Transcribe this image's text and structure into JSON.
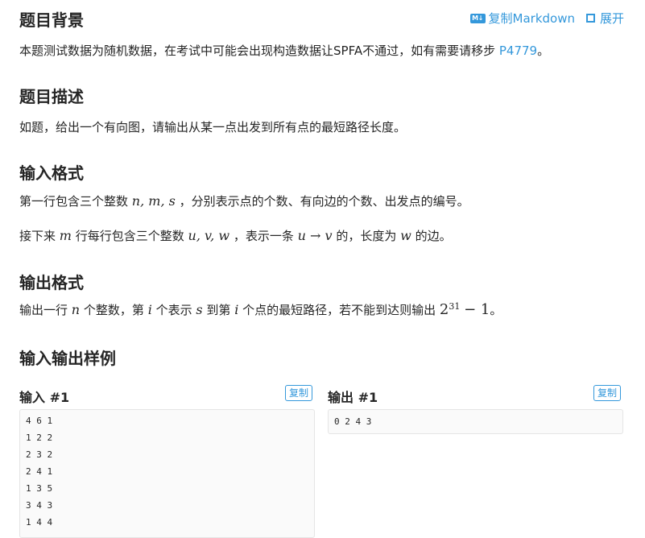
{
  "header_actions": {
    "copy_markdown_icon": "M↓",
    "copy_markdown": "复制Markdown",
    "expand": "展开"
  },
  "sections": {
    "background": {
      "title": "题目背景",
      "text": "本题测试数据为随机数据，在考试中可能会出现构造数据让SPFA不通过，如有需要请移步",
      "link": "P4779",
      "tail": "。"
    },
    "description": {
      "title": "题目描述",
      "text": "如题，给出一个有向图，请输出从某一点出发到所有点的最短路径长度。"
    },
    "input_format": {
      "title": "输入格式",
      "line1": {
        "pre": "第一行包含三个整数",
        "math": "n, m, s",
        "post": "，分别表示点的个数、有向边的个数、出发点的编号。"
      },
      "line2": {
        "pre": "接下来",
        "m1": "m",
        "mid1": "行每行包含三个整数",
        "m2": "u, v, w",
        "mid2": "，表示一条",
        "m3": "u → v",
        "mid3": "的，长度为",
        "m4": "w",
        "post": "的边。"
      }
    },
    "output_format": {
      "title": "输出格式",
      "line": {
        "pre": "输出一行",
        "m1": "n",
        "mid1": "个整数，第",
        "m2": "i",
        "mid2": "个表示",
        "m3": "s",
        "mid3": "到第",
        "m4": "i",
        "mid4": "个点的最短路径，若不能到达则输出",
        "base": "2",
        "exp": "31",
        "minus": "− 1",
        "post": "。"
      }
    },
    "samples": {
      "title": "输入输出样例",
      "input_label": "输入 #1",
      "output_label": "输出 #1",
      "copy": "复制",
      "input_lines": [
        "4 6 1",
        "1 2 2",
        "2 3 2",
        "2 4 1",
        "1 3 5",
        "3 4 3",
        "1 4 4"
      ],
      "output_lines": [
        "0 2 4 3"
      ]
    }
  },
  "colors": {
    "accent": "#3498db",
    "text": "#262626",
    "code_bg": "#fafafa",
    "border": "#e5e5e5"
  }
}
